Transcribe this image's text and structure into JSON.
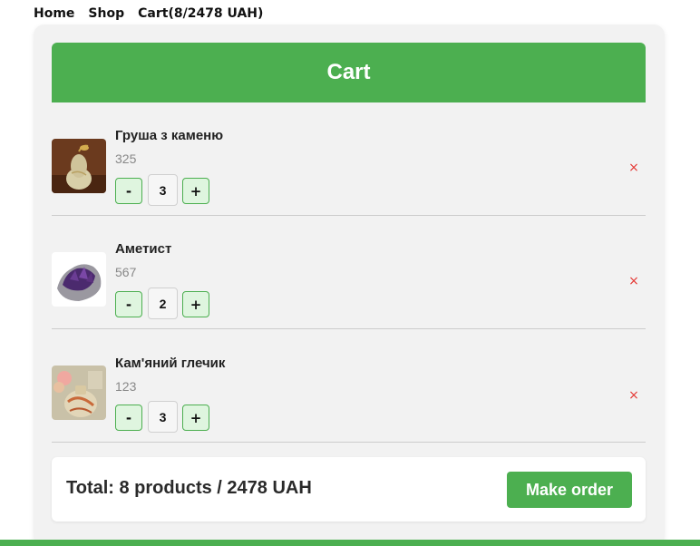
{
  "nav": {
    "home": "Home",
    "shop": "Shop",
    "cart": "Cart(8/2478 UAH)"
  },
  "cart": {
    "title": "Cart",
    "items": [
      {
        "name": "Груша з каменю",
        "price": "325",
        "quantity": "3",
        "decrement": "-",
        "increment": "+",
        "remove": "×",
        "thumbnail": "stone-pear-figurine"
      },
      {
        "name": "Аметист",
        "price": "567",
        "quantity": "2",
        "decrement": "-",
        "increment": "+",
        "remove": "×",
        "thumbnail": "amethyst-crystal"
      },
      {
        "name": "Кам'яний глечик",
        "price": "123",
        "quantity": "3",
        "decrement": "-",
        "increment": "+",
        "remove": "×",
        "thumbnail": "stone-jug"
      }
    ],
    "total": "Total: 8 products / 2478 UAH",
    "order_button": "Make order"
  },
  "colors": {
    "accent": "#4caf50",
    "remove": "#e53935",
    "panel": "#f2f2f2"
  }
}
